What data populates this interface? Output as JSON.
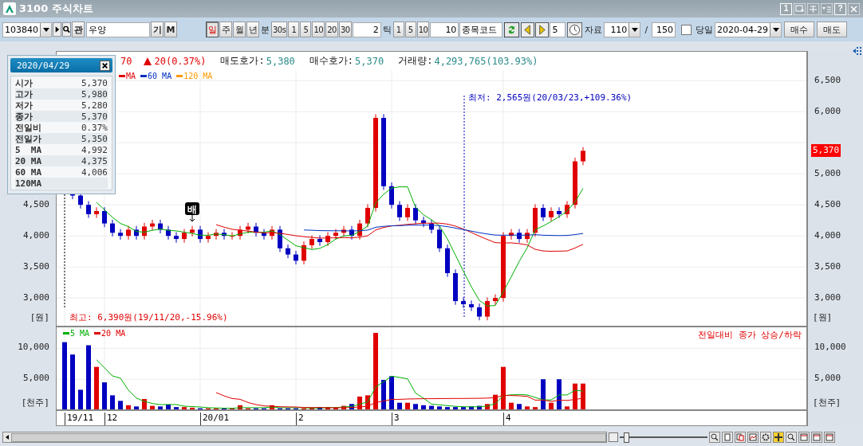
{
  "window": {
    "title": "3100 주식차트",
    "buttons": [
      {
        "kind": "text",
        "label": "1"
      },
      {
        "kind": "window"
      },
      {
        "kind": "pin"
      },
      {
        "kind": "menu"
      },
      {
        "kind": "text",
        "label": "?"
      },
      {
        "kind": "close"
      }
    ]
  },
  "toolbar": {
    "code": "103840",
    "lookup_button": "관",
    "name": "우양",
    "name_buttons": [
      "기",
      "M"
    ],
    "periods": [
      {
        "label": "일",
        "selected": true
      },
      {
        "label": "주",
        "selected": false
      },
      {
        "label": "월",
        "selected": false
      },
      {
        "label": "년",
        "selected": false
      }
    ],
    "minute_label": "분",
    "minutes": [
      "30s",
      "1",
      "5",
      "10",
      "20",
      "30"
    ],
    "minute_value": "2",
    "tick_label": "틱",
    "ticks": [
      "1",
      "5",
      "10"
    ],
    "tick_value": "10",
    "code_field": "종목코드",
    "step_value": "5",
    "data_label": "자료",
    "data_count": "110",
    "separator": "/",
    "data_max": "150",
    "today": {
      "label": "당일",
      "checked": false
    },
    "date": "2020-04-29",
    "actions": [
      "매수",
      "매도"
    ]
  },
  "quote": {
    "price": "70",
    "change": {
      "up": true,
      "text": "20(0.37%)"
    },
    "items": [
      {
        "label": "매도호가:",
        "value": "5,380"
      },
      {
        "label": "매수호가:",
        "value": "5,370"
      },
      {
        "label": "거래량:",
        "value": "4,293,765(103.93%)"
      }
    ]
  },
  "info_popup": {
    "date": "2020/04/29",
    "rows": [
      {
        "label": "시가",
        "value": "5,370"
      },
      {
        "label": "고가",
        "value": "5,980"
      },
      {
        "label": "저가",
        "value": "5,280"
      },
      {
        "label": "종가",
        "value": "5,370"
      },
      {
        "label": "전일비",
        "value": "0.37%"
      },
      {
        "label": "전일가",
        "value": "5,350"
      },
      {
        "label": "5  MA",
        "value": "4,992"
      },
      {
        "label": "20 MA",
        "value": "4,375"
      },
      {
        "label": "60 MA",
        "value": "4,006"
      },
      {
        "label": "120MA"
      }
    ]
  },
  "price_panel": {
    "legend": [
      {
        "label": "MA",
        "color": "#e00000"
      },
      {
        "label": "60 MA",
        "color": "#0030c0"
      },
      {
        "label": "120 MA",
        "color": "#ff9900"
      }
    ],
    "left_ticks": [
      "4,500",
      "4,000",
      "3,500",
      "3,000"
    ],
    "right_ticks": [
      "6,500",
      "6,000",
      "5,000",
      "4,500",
      "4,000",
      "3,500",
      "3,000"
    ],
    "unit_left": "[원]",
    "unit_right": "[원]",
    "current": "5,370",
    "marker": {
      "text": "배"
    },
    "annotations": [
      {
        "kind": "high",
        "text": "최고: 6,390원(19/11/20,-15.96%)"
      },
      {
        "kind": "low",
        "text": "최저: 2,565원(20/03/23,+109.36%)"
      }
    ]
  },
  "volume_panel": {
    "legend": [
      {
        "label": "5 MA",
        "color": "#00b000"
      },
      {
        "label": "20 MA",
        "color": "#e00000"
      }
    ],
    "note": "전일대비 종가 상승/하락",
    "left_ticks": [
      "10,000",
      "5,000"
    ],
    "right_ticks": [
      "10,000",
      "5,000"
    ],
    "unit_left": "[천주]",
    "unit_right": "[천주]"
  },
  "time_axis": [
    "19/11",
    "12",
    "20/01",
    "2",
    "3",
    "4"
  ],
  "bottom_bar": {
    "slider": {
      "level": 0.05
    },
    "tools": [
      {
        "kind": "zoom",
        "selected": false
      },
      {
        "kind": "page",
        "selected": false
      },
      {
        "kind": "pages",
        "selected": false
      },
      {
        "kind": "image",
        "selected": false
      },
      {
        "kind": "gear",
        "selected": false
      },
      {
        "kind": "crosshair",
        "selected": true
      },
      {
        "kind": "zoom",
        "selected": false
      },
      {
        "kind": "window",
        "selected": false
      },
      {
        "kind": "window",
        "selected": false
      },
      {
        "kind": "window",
        "selected": false
      }
    ]
  }
}
